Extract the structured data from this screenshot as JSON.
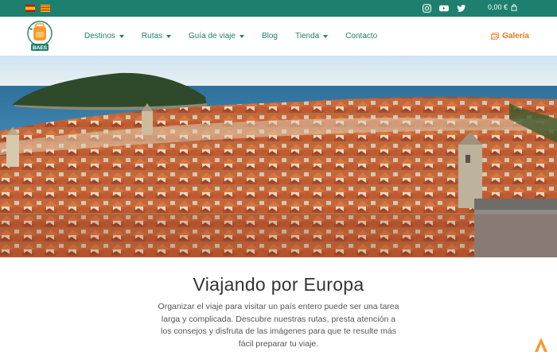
{
  "topbar": {
    "languages": [
      "es-flag",
      "ca-flag"
    ],
    "social_icons": [
      "instagram-icon",
      "youtube-icon",
      "twitter-icon"
    ],
    "cart_total": "0,00 €",
    "background_color": "#1f7f6e"
  },
  "logo": {
    "text": "BAES"
  },
  "nav": {
    "items": [
      {
        "label": "Destinos",
        "has_dropdown": true
      },
      {
        "label": "Rutas",
        "has_dropdown": true
      },
      {
        "label": "Guía de viaje",
        "has_dropdown": true
      },
      {
        "label": "Blog",
        "has_dropdown": false
      },
      {
        "label": "Tienda",
        "has_dropdown": true
      },
      {
        "label": "Contacto",
        "has_dropdown": false
      }
    ],
    "gallery_label": "Galería",
    "text_color": "#1f7f6e",
    "accent_color": "#e07b1f"
  },
  "hero": {
    "alt_description_icon": "city-panorama-image"
  },
  "main": {
    "title": "Viajando por Europa",
    "description": "Organizar el viaje para visitar un país entero puede ser una tarea larga y complicada. Descubre nuestras rutas, presta atención a los consejos y disfruta de las imágenes para que te resulte más fácil preparar tu viaje."
  }
}
